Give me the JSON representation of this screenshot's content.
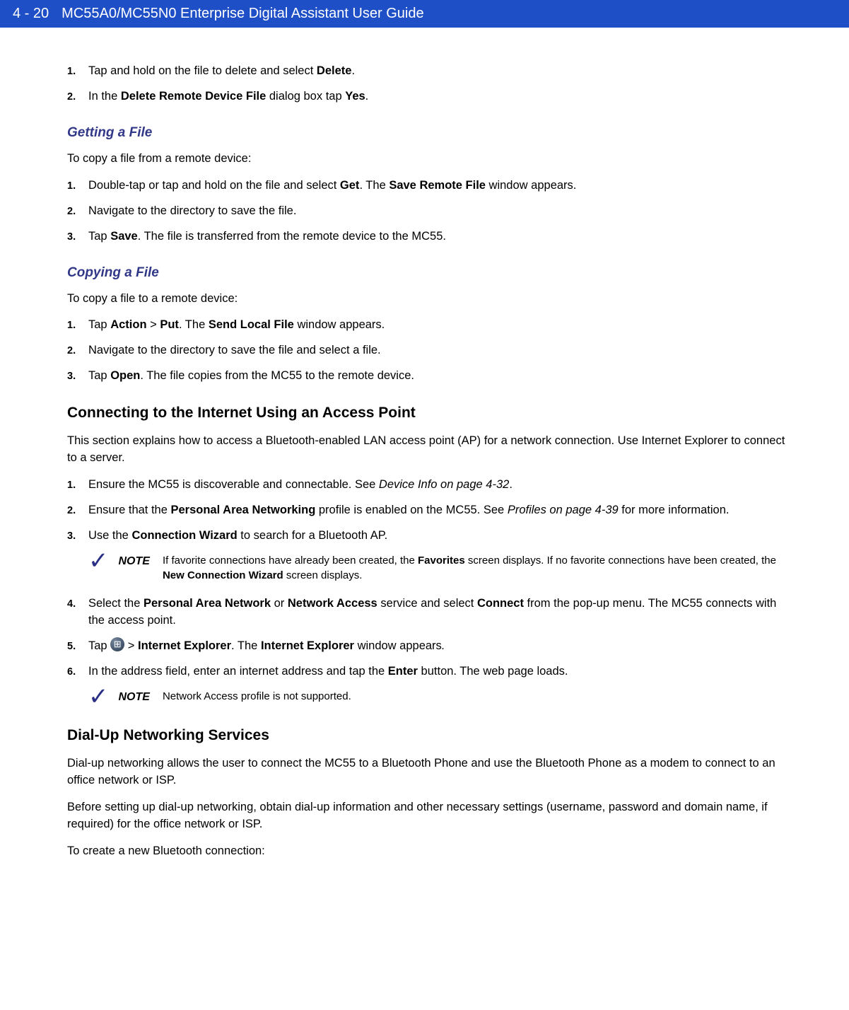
{
  "header": {
    "page_num": "4 - 20",
    "title": "MC55A0/MC55N0 Enterprise Digital Assistant User Guide"
  },
  "sec_delete": {
    "items": [
      {
        "num": "1.",
        "html": "Tap and hold on the file to delete and select <b>Delete</b>."
      },
      {
        "num": "2.",
        "html": "In the <b>Delete Remote Device File</b> dialog box tap <b>Yes</b>."
      }
    ]
  },
  "sec_getting": {
    "heading": "Getting a File",
    "intro": "To copy a file from a remote device:",
    "items": [
      {
        "num": "1.",
        "html": "Double-tap or tap and hold on the file and select <b>Get</b>. The <b>Save Remote File</b> window appears."
      },
      {
        "num": "2.",
        "html": "Navigate to the directory to save the file."
      },
      {
        "num": "3.",
        "html": "Tap <b>Save</b>. The file is transferred from the remote device to the MC55."
      }
    ]
  },
  "sec_copying": {
    "heading": "Copying a File",
    "intro": "To copy a file to a remote device:",
    "items": [
      {
        "num": "1.",
        "html": "Tap <b>Action</b> > <b>Put</b>. The <b>Send Local File</b> window appears."
      },
      {
        "num": "2.",
        "html": "Navigate to the directory to save the file and select a file."
      },
      {
        "num": "3.",
        "html": "Tap <b>Open</b>. The file copies from the MC55 to the remote device."
      }
    ]
  },
  "sec_ap": {
    "heading": "Connecting to the Internet Using an Access Point",
    "intro": "This section explains how to access a Bluetooth-enabled LAN access point (AP) for a network connection. Use Internet Explorer to connect to a server.",
    "items": [
      {
        "num": "1.",
        "html": "Ensure the MC55 is discoverable and connectable. See <i>Device Info on page 4-32</i>."
      },
      {
        "num": "2.",
        "html": "Ensure that the <b>Personal Area Networking</b> profile is enabled on the MC55. See <i>Profiles on page 4-39</i> for more information."
      },
      {
        "num": "3.",
        "html": "Use the <b>Connection Wizard</b> to search for a Bluetooth AP."
      },
      {
        "num": "4.",
        "html": "Select the <b>Personal Area Network</b> or <b>Network Access</b> service and select <b>Connect</b> from the pop-up menu. The MC55 connects with the access point."
      },
      {
        "num": "5.",
        "html": "Tap <span class=\"start-icon\" data-name=\"start-icon\" data-interactable=\"false\"></span> > <b>Internet Explorer</b>. The <b>Internet Explorer</b> window appears<i>.</i>"
      },
      {
        "num": "6.",
        "html": "In the address field, enter an internet address and tap the <b>Enter</b> button. The web page loads."
      }
    ],
    "note1_label": "NOTE",
    "note1_html": "If favorite connections have already been created, the <b>Favorites</b> screen displays. If no favorite connections have been created, the <b>New Connection Wizard</b> screen displays.",
    "note2_label": "NOTE",
    "note2_text": "Network Access profile is not supported."
  },
  "sec_dial": {
    "heading": "Dial-Up Networking Services",
    "para1": "Dial-up networking allows the user to connect the MC55 to a Bluetooth Phone and use the Bluetooth Phone as a modem to connect to an office network or ISP.",
    "para2": "Before setting up dial-up networking, obtain dial-up information and other necessary settings (username, password and domain name, if required) for the office network or ISP.",
    "para3": "To create a new Bluetooth connection:"
  }
}
